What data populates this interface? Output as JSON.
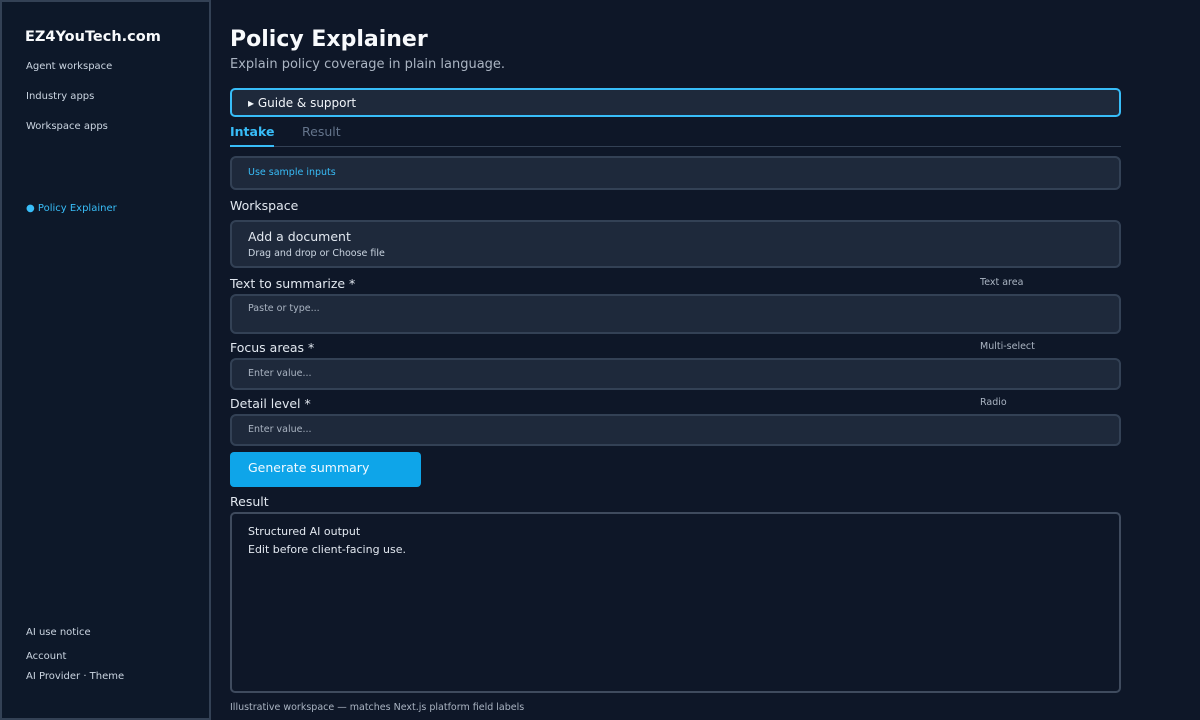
{
  "sidebar": {
    "brand": "EZ4YouTech.com",
    "nav": [
      "Agent workspace",
      "Industry apps",
      "Workspace apps"
    ],
    "active_item": "● Policy Explainer",
    "bottom": [
      "AI use notice",
      "Account",
      "AI Provider · Theme"
    ]
  },
  "page": {
    "title": "Policy Explainer",
    "subtitle": "Explain policy coverage in plain language."
  },
  "guide": {
    "label": "▸ Guide & support"
  },
  "tabs": [
    "Intake",
    "Result"
  ],
  "sample": {
    "label": "Use sample inputs"
  },
  "workspace": {
    "label": "Workspace",
    "upload_title": "Add a document",
    "upload_sub": "Drag and drop or Choose file"
  },
  "fields": [
    {
      "label": "Text to summarize *",
      "hint": "Text area",
      "placeholder": "Paste or type..."
    },
    {
      "label": "Focus areas *",
      "hint": "Multi-select",
      "placeholder": "Enter value..."
    },
    {
      "label": "Detail level *",
      "hint": "Radio",
      "placeholder": "Enter value..."
    }
  ],
  "generate_button": "Generate summary",
  "result": {
    "label": "Result",
    "lines": [
      "Structured AI output",
      "Edit before client-facing use."
    ]
  },
  "footer": "Illustrative workspace — matches Next.js platform field labels",
  "colors": {
    "background": "#0e1728",
    "accent": "#38bdf8",
    "button": "#0ea5e9",
    "panel": "#1e293b"
  }
}
